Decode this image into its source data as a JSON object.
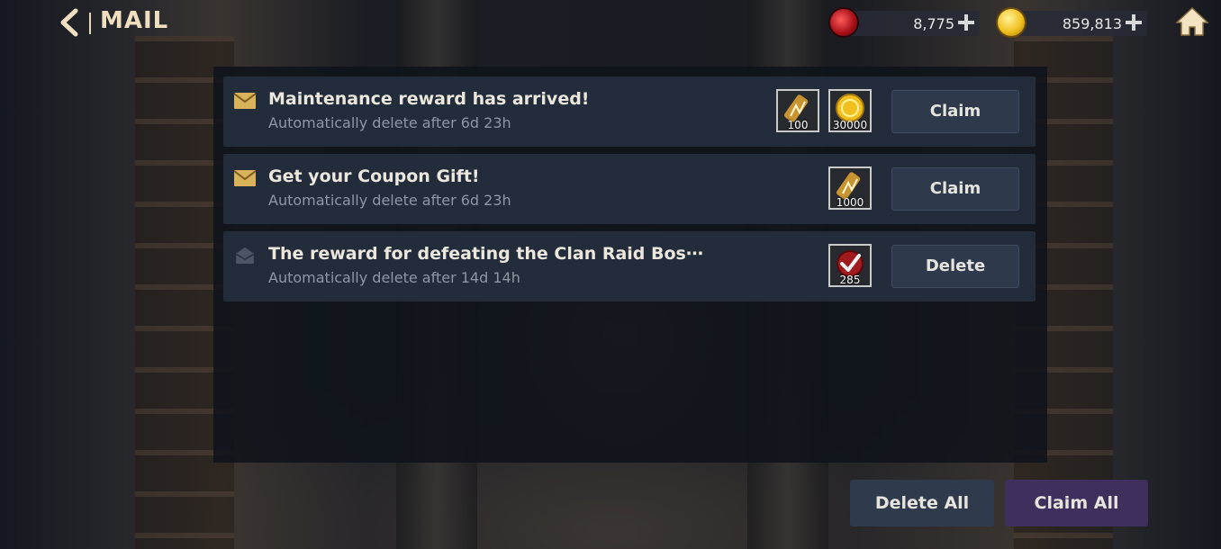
{
  "header": {
    "title": "MAIL",
    "resources": [
      {
        "name": "gem",
        "value": "8,775",
        "icon": "red-gem-icon"
      },
      {
        "name": "gold",
        "value": "859,813",
        "icon": "gold-coin-icon"
      }
    ]
  },
  "mails": [
    {
      "title": "Maintenance reward has arrived!",
      "subtitle": "Automatically delete after 6d 23h",
      "read": false,
      "rewards": [
        {
          "icon": "scroll-icon",
          "qty": "100"
        },
        {
          "icon": "gold-coin-icon",
          "qty": "30000"
        }
      ],
      "action": "Claim"
    },
    {
      "title": "Get your Coupon Gift!",
      "subtitle": "Automatically delete after 6d 23h",
      "read": false,
      "rewards": [
        {
          "icon": "scroll-icon",
          "qty": "1000"
        }
      ],
      "action": "Claim"
    },
    {
      "title": "The reward for defeating the Clan Raid Bos⋯",
      "subtitle": "Automatically delete after 14d 14h",
      "read": true,
      "rewards": [
        {
          "icon": "checkmark-ticket-icon",
          "qty": "285"
        }
      ],
      "action": "Delete"
    }
  ],
  "footer": {
    "delete_all": "Delete All",
    "claim_all": "Claim All"
  },
  "colors": {
    "accent_title": "#f0dfbf",
    "row_bg": "#222c3b",
    "claim_all_bg": "#3f2f5c"
  }
}
